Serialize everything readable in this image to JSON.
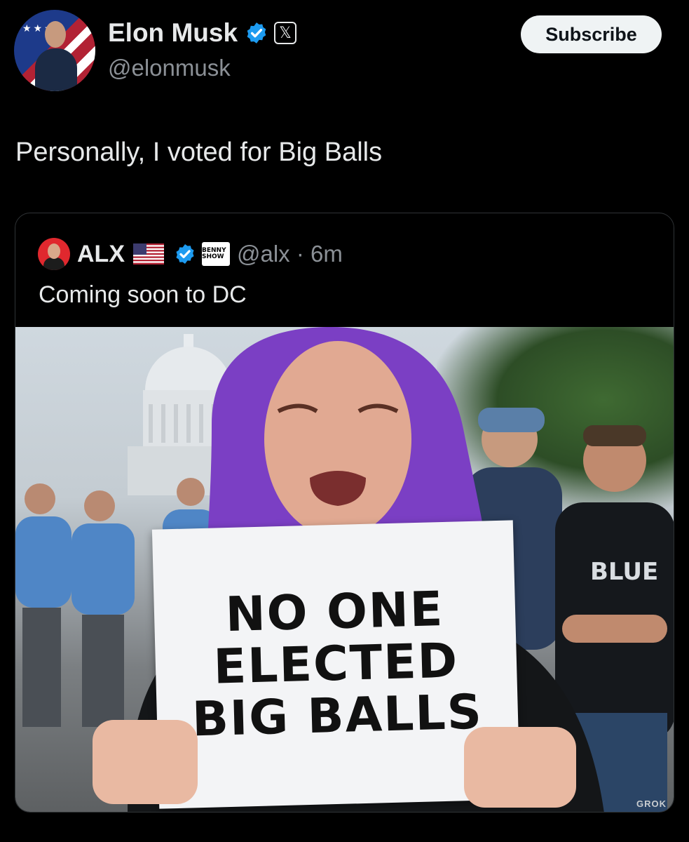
{
  "author": {
    "name": "Elon Musk",
    "handle": "@elonmusk",
    "subscribe_label": "Subscribe"
  },
  "post": {
    "text": "Personally, I voted for Big Balls"
  },
  "quoted": {
    "name": "ALX",
    "handle_time": "@alx · 6m",
    "text": "Coming soon to DC",
    "benny_badge": "BENNY SHOW",
    "image": {
      "sign_lines": [
        "NO ONE",
        "ELECTED",
        "BIG BALLS"
      ],
      "watermark": "GROK",
      "shirt_text": "BLUE"
    }
  },
  "colors": {
    "background": "#000000",
    "text": "#e7e9ea",
    "secondary_text": "#8b9096",
    "verified_blue": "#1d9bf0",
    "button_bg": "#eff3f4",
    "border": "#2f3336"
  }
}
